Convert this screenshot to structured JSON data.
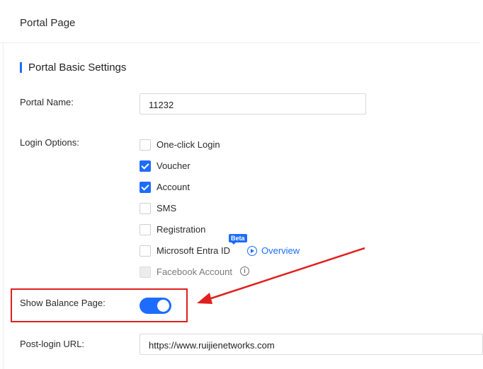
{
  "header": {
    "title": "Portal Page"
  },
  "section": {
    "title": "Portal Basic Settings"
  },
  "form": {
    "portal_name_label": "Portal Name:",
    "portal_name_value": "11232",
    "login_options_label": "Login Options:",
    "login_options": [
      {
        "label": "One-click Login",
        "checked": false,
        "disabled": false
      },
      {
        "label": "Voucher",
        "checked": true,
        "disabled": false
      },
      {
        "label": "Account",
        "checked": true,
        "disabled": false
      },
      {
        "label": "SMS",
        "checked": false,
        "disabled": false
      },
      {
        "label": "Registration",
        "checked": false,
        "disabled": false
      },
      {
        "label": "Microsoft Entra ID",
        "checked": false,
        "disabled": false
      },
      {
        "label": "Facebook Account",
        "checked": false,
        "disabled": true
      }
    ],
    "beta_badge": "Beta",
    "overview_link": "Overview",
    "info_icon": "i",
    "show_balance_label": "Show Balance Page:",
    "show_balance_enabled": true,
    "post_login_label": "Post-login URL:",
    "post_login_value": "https://www.ruijienetworks.com"
  },
  "colors": {
    "accent": "#1d6cff",
    "annotation": "#e0201f"
  },
  "icons": {
    "play": "play-circle-icon",
    "info": "info-circle-icon",
    "check": "checkmark-icon"
  }
}
